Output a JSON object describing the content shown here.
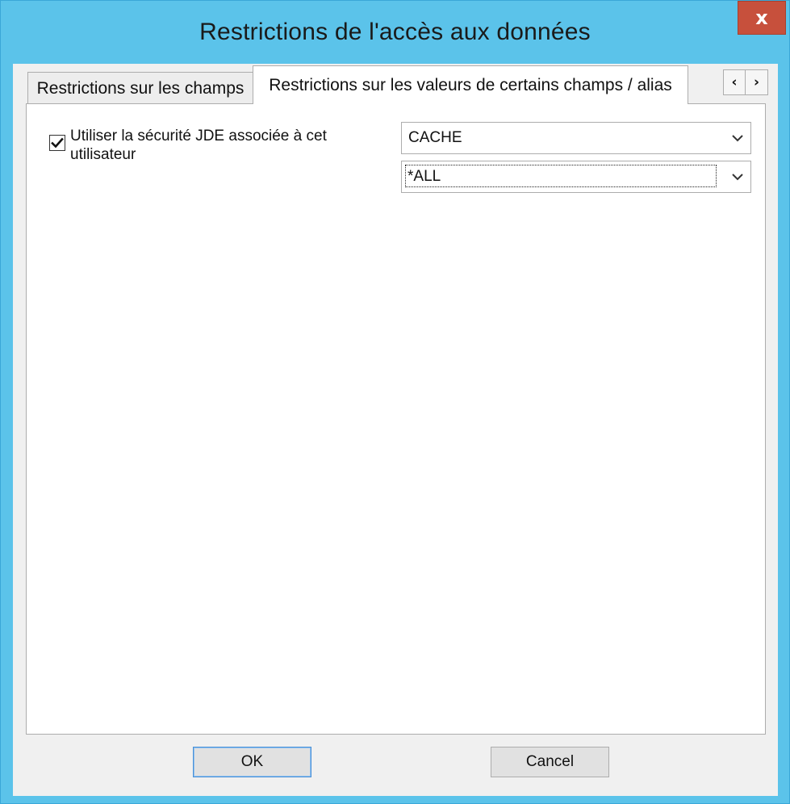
{
  "window": {
    "title": "Restrictions de l'accès aux données",
    "close_glyph": "x"
  },
  "tabs": [
    {
      "label": "Restrictions sur les champs",
      "selected": false
    },
    {
      "label": "Restrictions sur les valeurs de certains champs / alias",
      "selected": true
    }
  ],
  "tab_scroll": {
    "left_glyph": "‹",
    "right_glyph": "›"
  },
  "panel": {
    "use_jde_security": {
      "label": "Utiliser la sécurité JDE associée à cet utilisateur",
      "checked": true
    },
    "combo_1": {
      "value": "CACHE"
    },
    "combo_2": {
      "value": "*ALL"
    }
  },
  "buttons": {
    "ok_label": "OK",
    "cancel_label": "Cancel"
  },
  "colors": {
    "title_bar": "#5bc3ea",
    "close_button": "#c7503c",
    "dialog_background": "#f0f0f0",
    "panel_background": "#ffffff",
    "default_button_border": "#4a90d6"
  },
  "icons": {
    "close": "close-icon",
    "tab_left": "chevron-left-icon",
    "tab_right": "chevron-right-icon",
    "check": "checkmark-icon",
    "dropdown": "chevron-down-icon"
  }
}
